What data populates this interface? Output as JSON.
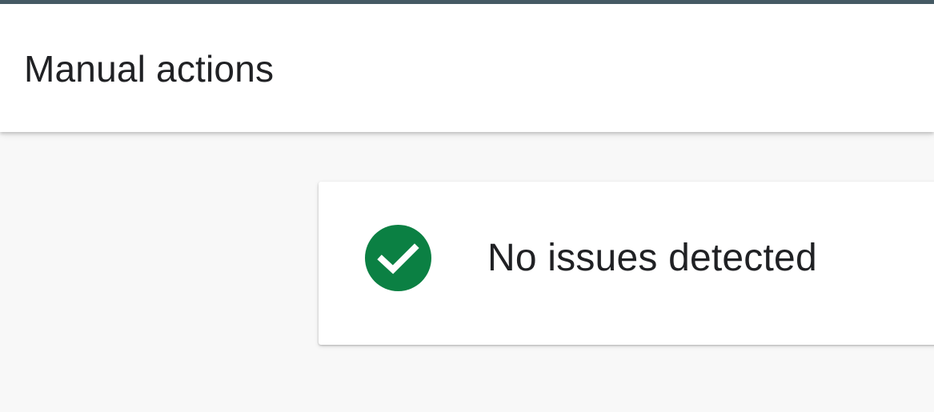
{
  "header": {
    "title": "Manual actions"
  },
  "status": {
    "message": "No issues detected",
    "icon": "check-circle-icon"
  },
  "colors": {
    "top_strip": "#455a64",
    "success": "#0b8043",
    "background": "#f8f8f8",
    "text": "#202124"
  }
}
